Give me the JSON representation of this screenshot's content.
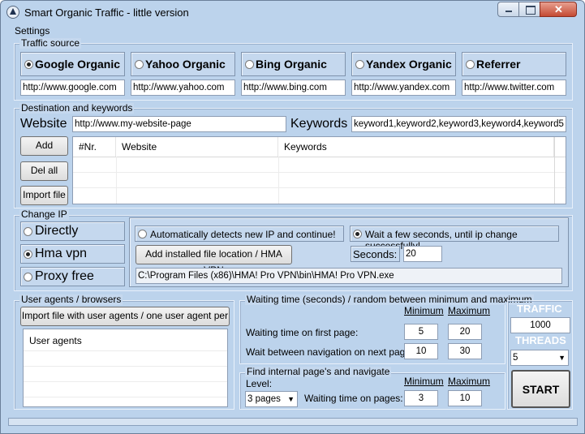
{
  "window": {
    "title": "Smart Organic Traffic - little version",
    "icon": "app-logo-icon"
  },
  "menu": {
    "settings": "Settings"
  },
  "traffic_source": {
    "legend": "Traffic source",
    "engines": [
      {
        "label": "Google Organic",
        "url": "http://www.google.com",
        "selected": true
      },
      {
        "label": "Yahoo Organic",
        "url": "http://www.yahoo.com",
        "selected": false
      },
      {
        "label": "Bing Organic",
        "url": "http://www.bing.com",
        "selected": false
      },
      {
        "label": "Yandex Organic",
        "url": "http://www.yandex.com",
        "selected": false
      },
      {
        "label": "Referrer",
        "url": "http://www.twitter.com",
        "selected": false
      }
    ]
  },
  "destination": {
    "legend": "Destination and keywords",
    "website_label": "Website",
    "website_value": "http://www.my-website-page",
    "keywords_label": "Keywords",
    "keywords_value": "keyword1,keyword2,keyword3,keyword4,keyword5",
    "add_label": "Add",
    "delall_label": "Del all",
    "import_label": "Import file",
    "table": {
      "columns": [
        "#Nr.",
        "Website",
        "Keywords"
      ],
      "rows": []
    }
  },
  "change_ip": {
    "legend": "Change IP",
    "options": [
      {
        "label": "Directly",
        "selected": false
      },
      {
        "label": "Hma vpn",
        "selected": true
      },
      {
        "label": "Proxy free",
        "selected": false
      }
    ],
    "auto_detect_label": "Automatically detects new IP and continue!",
    "auto_detect_selected": false,
    "wait_label": "Wait a few seconds, until ip change successfully!",
    "wait_selected": true,
    "add_location_label": "Add installed file location / HMA VPN",
    "seconds_label": "Seconds:",
    "seconds_value": "20",
    "path_value": "C:\\Program Files (x86)\\HMA! Pro VPN\\bin\\HMA! Pro VPN.exe"
  },
  "user_agents": {
    "legend": "User agents / browsers",
    "import_label": "Import file with user agents / one user agent per row",
    "list_header": "User agents"
  },
  "waiting": {
    "legend": "Waiting time (seconds) / random between minimum and maximum",
    "min_label": "Minimum",
    "max_label": "Maximum",
    "first_page_label": "Waiting time on first page:",
    "first_min": "5",
    "first_max": "20",
    "between_label": "Wait between navigation on next page:",
    "between_min": "10",
    "between_max": "30"
  },
  "internal": {
    "legend": "Find internal page's and navigate",
    "level_label": "Level:",
    "level_value": "3 pages",
    "min_label": "Minimum",
    "max_label": "Maximum",
    "pages_label": "Waiting time on pages:",
    "pages_min": "3",
    "pages_max": "10"
  },
  "right_panel": {
    "traffic_label": "TRAFFIC",
    "traffic_value": "1000",
    "threads_label": "THREADS",
    "threads_value": "5",
    "start_label": "START"
  },
  "colors": {
    "window_bg": "#bcd3ec",
    "panel_label": "#ffffff"
  }
}
